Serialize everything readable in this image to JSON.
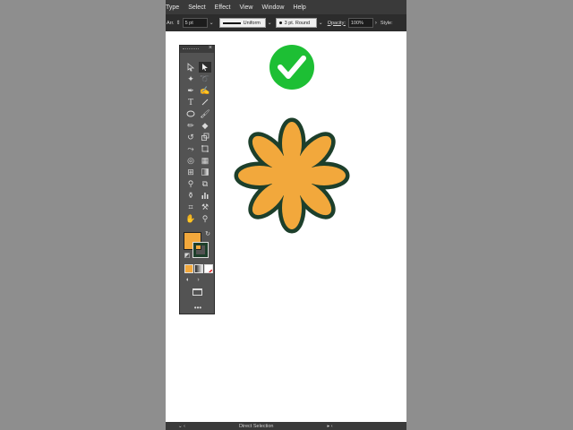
{
  "menu": {
    "items": [
      "Type",
      "Select",
      "Effect",
      "View",
      "Window",
      "Help"
    ]
  },
  "control_bar": {
    "left_label": "Arr.",
    "stroke_weight": "5 pt",
    "profile_label": "Uniform",
    "brush_label": "3 pt. Round",
    "opacity_label": "Opacity:",
    "opacity_value": "100%",
    "style_label": "Style:"
  },
  "status_bar": {
    "text": "Direct Selection"
  },
  "colors": {
    "fill": "#f2a83c",
    "stroke": "#1d3f2b",
    "check_badge": "#1dbf34",
    "ui_dark": "#535353",
    "background": "#8e8e8e"
  },
  "tools": [
    "selection-tool",
    "direct-selection-tool",
    "magic-wand-tool",
    "lasso-tool",
    "pen-tool",
    "curvature-tool",
    "type-tool",
    "line-segment-tool",
    "ellipse-tool",
    "paintbrush-tool",
    "pencil-tool",
    "eraser-tool",
    "rotate-tool",
    "scale-tool",
    "width-tool",
    "free-transform-tool",
    "shape-builder-tool",
    "perspective-grid-tool",
    "mesh-tool",
    "gradient-tool",
    "eyedropper-tool",
    "blend-tool",
    "symbol-sprayer-tool",
    "column-graph-tool",
    "artboard-tool",
    "slice-tool",
    "hand-tool",
    "zoom-tool"
  ]
}
